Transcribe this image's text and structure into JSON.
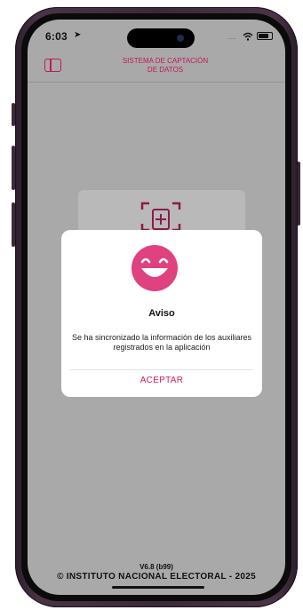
{
  "status_bar": {
    "time": "6:03",
    "signal_dots": "....",
    "location_icon": "navigation-arrow-icon",
    "wifi_icon": "wifi-icon",
    "battery_icon": "battery-icon"
  },
  "header": {
    "menu_icon": "sidebar-toggle-icon",
    "title": "SISTEMA DE CAPTACIÓN\nDE DATOS"
  },
  "background_card": {
    "icon": "scan-add-icon"
  },
  "dialog": {
    "icon": "smile-face-icon",
    "title": "Aviso",
    "message": "Se ha sincronizado la información de los auxiliares registrados en la aplicación",
    "accept_label": "ACEPTAR"
  },
  "footer": {
    "version": "V6.8 (b99)",
    "copyright": "© INSTITUTO NACIONAL ELECTORAL - 2025"
  },
  "colors": {
    "accent": "#c2185b",
    "accent_bright": "#e0417f",
    "overlay_gray": "#a9a9a9",
    "dialog_bg": "#ffffff"
  }
}
